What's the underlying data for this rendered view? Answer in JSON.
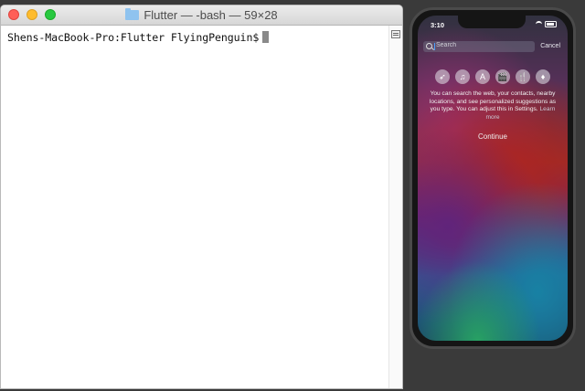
{
  "terminal": {
    "title": "Flutter — -bash — 59×28",
    "folder_icon": "folder-icon",
    "prompt": "Shens-MacBook-Pro:Flutter FlyingPenguin$"
  },
  "phone": {
    "status_time": "3:10",
    "search": {
      "placeholder": "Search",
      "cancel": "Cancel"
    },
    "app_icons": [
      "safari-icon",
      "music-icon",
      "app-store-icon",
      "movies-icon",
      "restaurants-icon",
      "tips-icon"
    ],
    "app_glyphs": [
      "➶",
      "♫",
      "A",
      "🎬",
      "🍴",
      "♦"
    ],
    "description": "You can search the web, your contacts, nearby locations, and see personalized suggestions as you type. You can adjust this in Settings.",
    "learn_more": "Learn more",
    "continue": "Continue"
  },
  "colors": {
    "close": "#ff5f57",
    "minimize": "#febc2e",
    "zoom": "#28c840",
    "desktop": "#3a3a3a"
  }
}
